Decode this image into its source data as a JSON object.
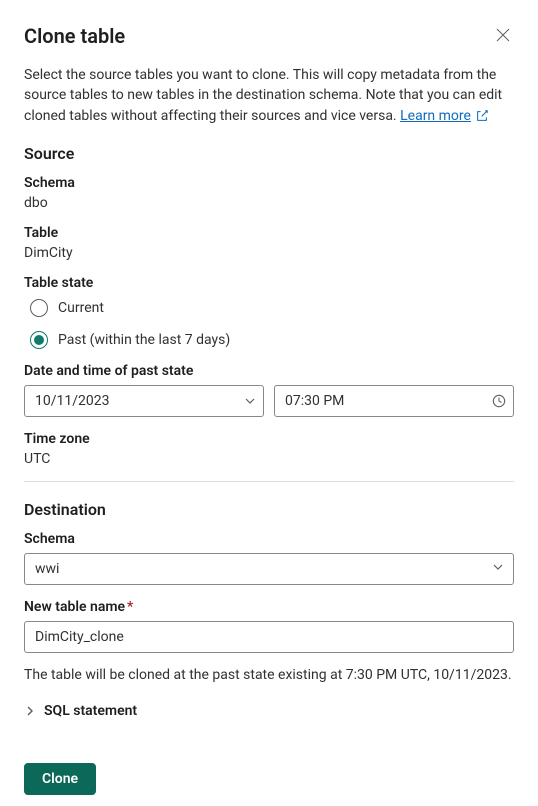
{
  "dialog": {
    "title": "Clone table",
    "description_prefix": "Select the source tables you want to clone. This will copy metadata from the source tables to new tables in the destination schema. Note that you can edit cloned tables without affecting their sources and vice versa. ",
    "learn_more": "Learn more"
  },
  "source": {
    "heading": "Source",
    "schema_label": "Schema",
    "schema_value": "dbo",
    "table_label": "Table",
    "table_value": "DimCity",
    "state_label": "Table state",
    "radio_current": "Current",
    "radio_past": "Past (within the last 7 days)",
    "datetime_label": "Date and time of past state",
    "date_value": "10/11/2023",
    "time_value": "07:30 PM",
    "timezone_label": "Time zone",
    "timezone_value": "UTC"
  },
  "destination": {
    "heading": "Destination",
    "schema_label": "Schema",
    "schema_value": "wwi",
    "newname_label": "New table name",
    "newname_value": "DimCity_clone"
  },
  "summary": "The table will be cloned at the past state existing at 7:30 PM UTC, 10/11/2023.",
  "sql_expander": "SQL statement",
  "actions": {
    "clone": "Clone"
  }
}
